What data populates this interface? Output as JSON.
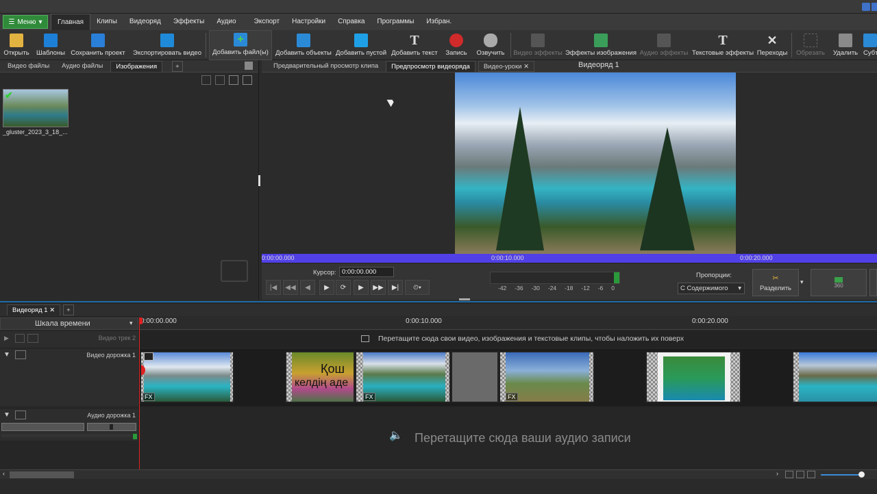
{
  "menubar": {
    "menu_button": "Меню",
    "items": [
      "Главная",
      "Клипы",
      "Видеоряд",
      "Эффекты",
      "Аудио",
      "Экспорт",
      "Настройки",
      "Справка",
      "Программы",
      "Избран."
    ]
  },
  "toolbar": {
    "open": "Открыть",
    "templates": "Шаблоны",
    "save_project": "Сохранить проект",
    "export_video": "Экспортировать видео",
    "add_files": "Добавить файл(ы)",
    "add_objects": "Добавить объекты",
    "add_blank": "Добавить пустой",
    "add_text": "Добавить текст",
    "record": "Запись",
    "voice": "Озвучить",
    "video_effects": "Видео эффекты",
    "image_effects": "Эффекты изображения",
    "audio_effects": "Аудио эффекты",
    "text_effects": "Текстовые эффекты",
    "transitions": "Переходы",
    "crop": "Обрезать",
    "delete": "Удалить",
    "subtitles": "Субт"
  },
  "media_panel": {
    "tabs": [
      "Видео файлы",
      "Аудио файлы",
      "Изображения"
    ],
    "add_tab": "+",
    "file_name": "_gluster_2023_3_18_..."
  },
  "preview": {
    "tabs": [
      "Предварительный просмотр клипа",
      "Предпросмотр видеоряда",
      "Видео-уроки"
    ],
    "title": "Видеоряд 1",
    "scrubber_times": [
      "0:00:00.000",
      "0:00:10.000",
      "0:00:20.000"
    ],
    "cursor_label": "Курсор:",
    "cursor_value": "0:00:00.000",
    "meter_scale": [
      "-42",
      "-36",
      "-30",
      "-24",
      "-18",
      "-12",
      "-6",
      "0"
    ],
    "proportions_label": "Пропорции:",
    "proportions_value": "С Содержимого",
    "split_label": "Разделить",
    "badge_360": "360"
  },
  "timeline": {
    "tab": "Видеоряд 1",
    "add_tab": "+",
    "scale_label": "Шкала времени",
    "times": [
      "0:00:00.000",
      "0:00:10.000",
      "0:00:20.000"
    ],
    "video_track2": "Видео трек 2",
    "overlay_hint": "Перетащите сюда свои видео, изображения и текстовые клипы, чтобы наложить их поверх",
    "video_track1": "Видео дорожка 1",
    "audio_track1": "Аудио дорожка 1",
    "audio_hint": "Перетащите сюда ваши аудио записи",
    "clip_text_1": "Қош",
    "clip_text_2": "келдің аде",
    "fx": "FX"
  },
  "colors": {
    "accent_green": "#2f8a3a",
    "scrubber": "#5140e6",
    "timeline_border": "#1f6aa8"
  }
}
